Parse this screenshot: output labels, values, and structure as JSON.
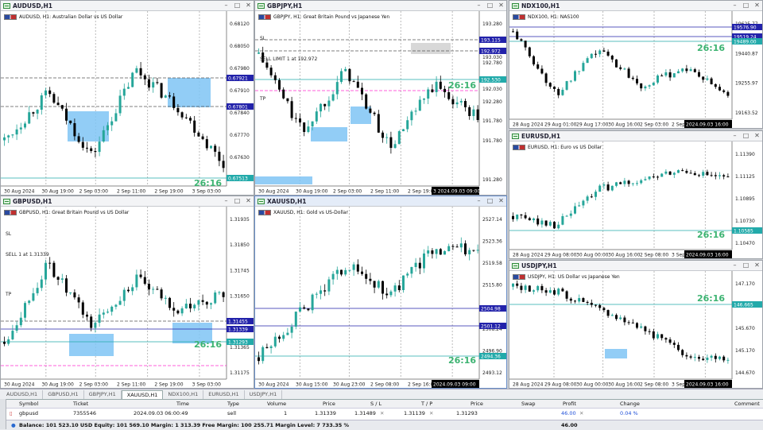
{
  "windows": [
    {
      "id": "audusd",
      "title": "AUDUSD,H1",
      "legend": "AUDUSD, H1:  Australian Dollar vs US Dollar",
      "prices": [
        "0.68120",
        "0.68050",
        "0.67980",
        "0.67910",
        "0.67840",
        "0.67770",
        "0.67630",
        "0.67560"
      ],
      "badges": [
        "0.67921",
        "0.67801",
        "0.67513"
      ],
      "times": [
        "30 Aug 2024",
        "30 Aug 19:00",
        "2 Sep 03:00",
        "2 Sep 11:00",
        "2 Sep 19:00",
        "3 Sep 03:00"
      ],
      "countdown": "26:16",
      "labels": []
    },
    {
      "id": "gbpjpy",
      "title": "GBPJPY,H1",
      "legend": "GBPJPY, H1:  Great Britain Pound vs Japanese Yen",
      "prices": [
        "193.280",
        "192.780",
        "192.280",
        "191.780",
        "191.280"
      ],
      "badges": [
        "193.115",
        "192.972",
        "192.530"
      ],
      "times": [
        "30 Aug 2024",
        "30 Aug 19:00",
        "2 Sep 03:00",
        "2 Sep 11:00",
        "2 Sep 19:00",
        "3 2024.09.03 09:00"
      ],
      "countdown": "26:16",
      "labels": [
        "SL",
        "SELL LIMIT 1 at 192.972",
        "TP"
      ],
      "extra_prices": [
        "193.030",
        "192.030",
        "191.780"
      ]
    },
    {
      "id": "ndx100",
      "title": "NDX100,H1",
      "legend": "NDX100, H1:  NAS100",
      "prices": [
        "19625.77",
        "19440.87",
        "19255.97",
        "19163.52"
      ],
      "badges": [
        "19576.90",
        "19519.24",
        "19489.00"
      ],
      "times": [
        "28 Aug 2024",
        "29 Aug 01:00",
        "29 Aug 17:00",
        "30 Aug 16:00",
        "2 Sep 03:00",
        "2 Sep",
        "2024.09.03 16:00"
      ],
      "countdown": "26:16",
      "labels": []
    },
    {
      "id": "gbpusd",
      "title": "GBPUSD,H1",
      "legend": "GBPUSD, H1:  Great Britain Pound vs US Dollar",
      "prices": [
        "1.31935",
        "1.31850",
        "1.31745",
        "1.31650",
        "1.31555",
        "1.31365",
        "1.31175"
      ],
      "badges": [
        "1.31455",
        "1.31339",
        "1.31293"
      ],
      "times": [
        "30 Aug 2024",
        "30 Aug 19:00",
        "2 Sep 03:00",
        "2 Sep 11:00",
        "2 Sep 19:00",
        "3 Sep 03:00"
      ],
      "countdown": "26:16",
      "labels": [
        "SL",
        "SELL 1 at 1.31339",
        "TP"
      ]
    },
    {
      "id": "xauusd",
      "title": "XAUUSD,H1",
      "legend": "XAUUSD, H1:  Gold vs US-Dollar",
      "prices": [
        "2527.14",
        "2523.36",
        "2519.58",
        "2515.80",
        "2512.02",
        "2508.24",
        "2496.90",
        "2493.12"
      ],
      "badges": [
        "2504.98",
        "2501.12",
        "2494.36"
      ],
      "times": [
        "30 Aug 2024",
        "30 Aug 15:00",
        "30 Aug 23:00",
        "2 Sep 08:00",
        "2 Sep 16:00",
        "2024.09.03 09:00"
      ],
      "countdown": "26:16",
      "labels": []
    },
    {
      "id": "eurusd",
      "title": "EURUSD,H1",
      "legend": "EURUSD, H1:  Euro vs US Dollar",
      "prices": [
        "1.11390",
        "1.11125",
        "1.10895",
        "1.10730",
        "1.10470"
      ],
      "badges": [
        "1.10585"
      ],
      "times": [
        "28 Aug 2024",
        "29 Aug 08:00",
        "30 Aug 00:00",
        "30 Aug 16:00",
        "2 Sep 08:00",
        "3 Sep",
        "2024.09.03 16:00"
      ],
      "countdown": "26:16",
      "labels": []
    },
    {
      "id": "usdjpy",
      "title": "USDJPY,H1",
      "legend": "USDJPY, H1:  US Dollar vs Japanese Yen",
      "prices": [
        "147.170",
        "146.170",
        "145.670",
        "145.170",
        "144.670"
      ],
      "badges": [
        "146.665"
      ],
      "times": [
        "28 Aug 2024",
        "29 Aug 08:00",
        "30 Aug 00:00",
        "30 Aug 16:00",
        "2 Sep 08:00",
        "3 Sep",
        "2024.09.03 16:00"
      ],
      "countdown": "26:16",
      "labels": []
    }
  ],
  "tabs": [
    "AUDUSD,H1",
    "GBPUSD,H1",
    "GBPJPY,H1",
    "XAUUSD,H1",
    "NDX100,H1",
    "EURUSD,H1",
    "USDJPY,H1"
  ],
  "active_tab": "XAUUSD,H1",
  "table": {
    "headers": [
      "Symbol",
      "Ticket",
      "Time",
      "Type",
      "Volume",
      "Price",
      "S / L",
      "T / P",
      "Price",
      "Swap",
      "Profit",
      "Change",
      "Comment"
    ],
    "row": {
      "symbol": "gbpusd",
      "ticket": "7355546",
      "time": "2024.09.03 06:00:49",
      "type": "sell",
      "volume": "1",
      "price": "1.31339",
      "sl": "1.31489",
      "tp": "1.31139",
      "cur_price": "1.31293",
      "swap": "",
      "profit": "46.00",
      "change": "0.04 %",
      "comment": ""
    }
  },
  "status": {
    "text": "Balance: 101 523.10 USD  Equity: 101 569.10  Margin: 1 313.39  Free Margin: 100 255.71  Margin Level: 7 733.35 %",
    "profit": "46.00"
  },
  "colors": {
    "bull": "#26a69a",
    "bear": "#000000",
    "zone": "#7fc4f5",
    "grey_zone": "#d8d8d8",
    "countdown": "#3cb371",
    "level_line": "#2222aa",
    "magenta": "#ff2bd0"
  }
}
